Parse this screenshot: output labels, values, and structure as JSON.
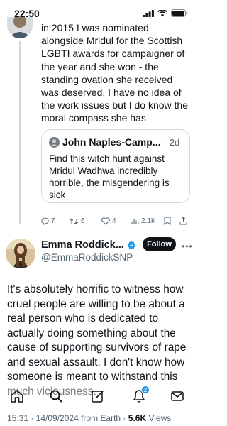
{
  "status_bar": {
    "time": "22:50"
  },
  "previous_tweet": {
    "text": "in 2015 I was nominated alongside Mridul for the Scottish LGBTI awards for campaigner of the year and she won - the standing ovation she received was deserved. I have no idea of the work issues but I do know the moral compass she has",
    "quote": {
      "name": "John Naples-Camp...",
      "separator": "·",
      "date": "2d",
      "text": "Find this witch hunt against Mridul Wadhwa incredibly horrible, the misgendering is sick"
    },
    "actions": {
      "reply_count": "7",
      "retweet_count": "6",
      "like_count": "4",
      "views_count": "2.1K"
    }
  },
  "main_tweet": {
    "author_name": "Emma Roddick...",
    "author_handle": "@EmmaRoddickSNP",
    "follow_label": "Follow",
    "text": "It's absolutely horrific to witness how cruel people are willing to be about a real person who is dedicated to actually doing something about the cause of supporting survivors of rape and sexual assault.  I don't know how someone is meant to withstand this much viciousness.",
    "timestamp": "15:31 · 14/09/2024 from Earth · ",
    "views_count": "5.6K",
    "views_label": "Views"
  },
  "tab_bar": {
    "items": [
      "home-icon",
      "search-icon",
      "compose-icon",
      "notifications-icon",
      "messages-icon"
    ],
    "notification_badge": "2"
  },
  "colors": {
    "accent": "#1d9bf0",
    "text": "#0f1419",
    "muted": "#536471",
    "border": "#cfd9de"
  }
}
